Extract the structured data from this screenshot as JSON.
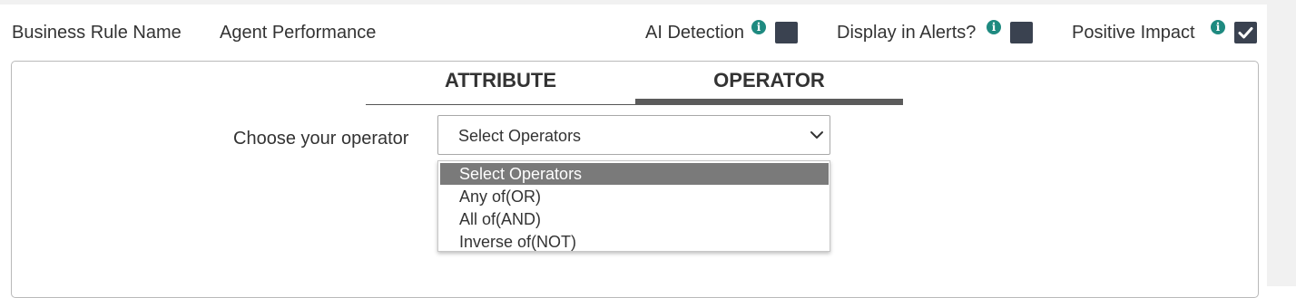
{
  "header": {
    "rule_name_label": "Business Rule Name",
    "rule_name_value": "Agent Performance",
    "ai_detection_label": "AI Detection",
    "ai_detection_checked": false,
    "display_alerts_label": "Display in Alerts?",
    "display_alerts_checked": false,
    "positive_impact_label": "Positive Impact",
    "positive_impact_checked": true,
    "info_glyph": "i"
  },
  "tabs": [
    {
      "label": "ATTRIBUTE",
      "active": false
    },
    {
      "label": "OPERATOR",
      "active": true
    }
  ],
  "operator": {
    "label": "Choose your operator",
    "selected": "Select Operators",
    "options": [
      "Select Operators",
      "Any of(OR)",
      "All of(AND)",
      "Inverse of(NOT)"
    ]
  },
  "colors": {
    "info_icon": "#1e8a80",
    "checkbox": "#3a4250",
    "active_tab_underline": "#5b5b5b",
    "highlighted_option": "#7a7a7a"
  }
}
